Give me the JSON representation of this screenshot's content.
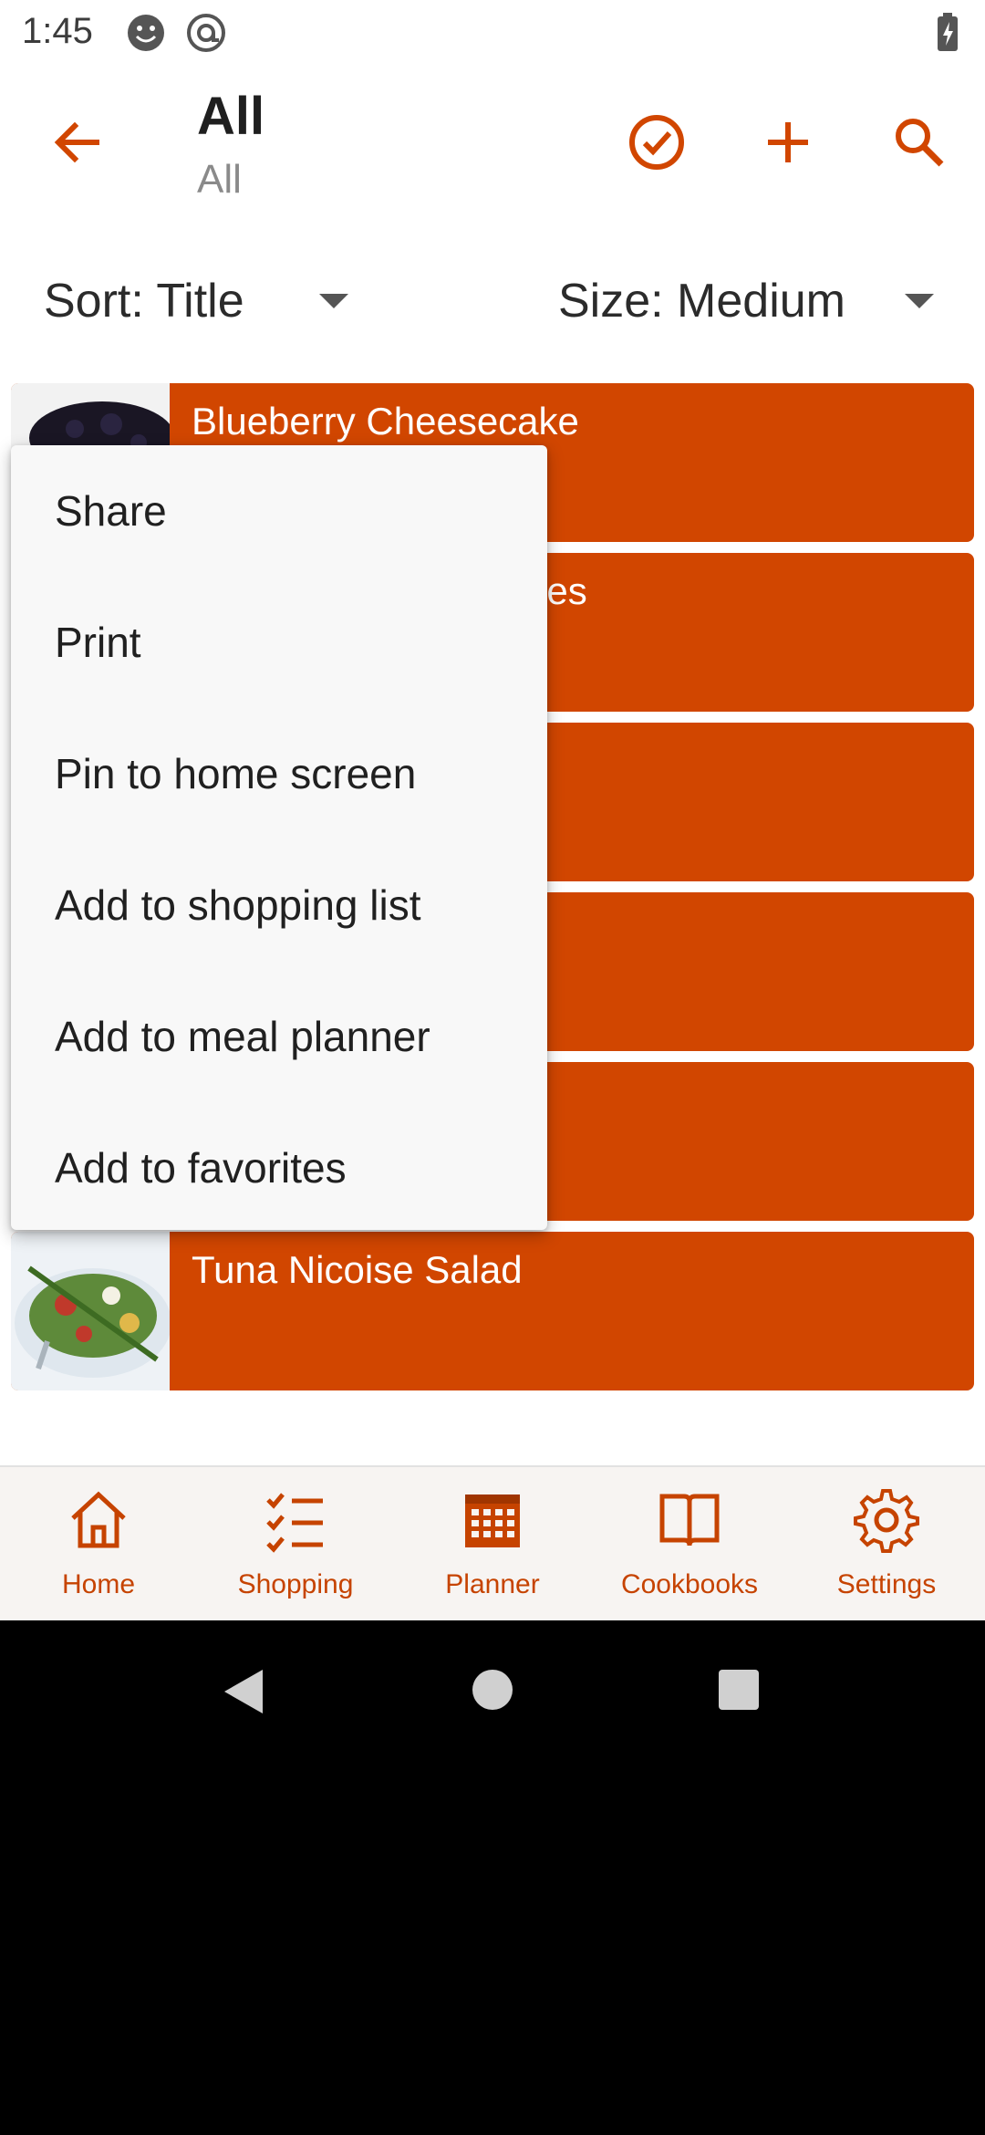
{
  "status_bar": {
    "time": "1:45"
  },
  "app_bar": {
    "title": "All",
    "subtitle": "All",
    "back_icon": "arrow-left-icon",
    "actions": [
      "check-circle-icon",
      "plus-icon",
      "search-icon"
    ]
  },
  "filters": {
    "sort_label": "Sort: Title",
    "size_label": "Size: Medium"
  },
  "recipes": [
    {
      "title": "Blueberry Cheesecake"
    },
    {
      "title": "ies"
    },
    {
      "title": ""
    },
    {
      "title": ""
    },
    {
      "title": ""
    },
    {
      "title": "Tuna Nicoise Salad"
    }
  ],
  "menu": {
    "items": [
      "Share",
      "Print",
      "Pin to home screen",
      "Add to shopping list",
      "Add to meal planner",
      "Add to favorites"
    ]
  },
  "bottom_nav": {
    "items": [
      {
        "label": "Home",
        "icon": "home-icon"
      },
      {
        "label": "Shopping",
        "icon": "checklist-icon"
      },
      {
        "label": "Planner",
        "icon": "calendar-icon"
      },
      {
        "label": "Cookbooks",
        "icon": "book-icon"
      },
      {
        "label": "Settings",
        "icon": "gear-icon"
      }
    ]
  },
  "colors": {
    "accent": "#d14600",
    "nav_label": "#c64300",
    "menu_bg": "#f8f8f8"
  }
}
